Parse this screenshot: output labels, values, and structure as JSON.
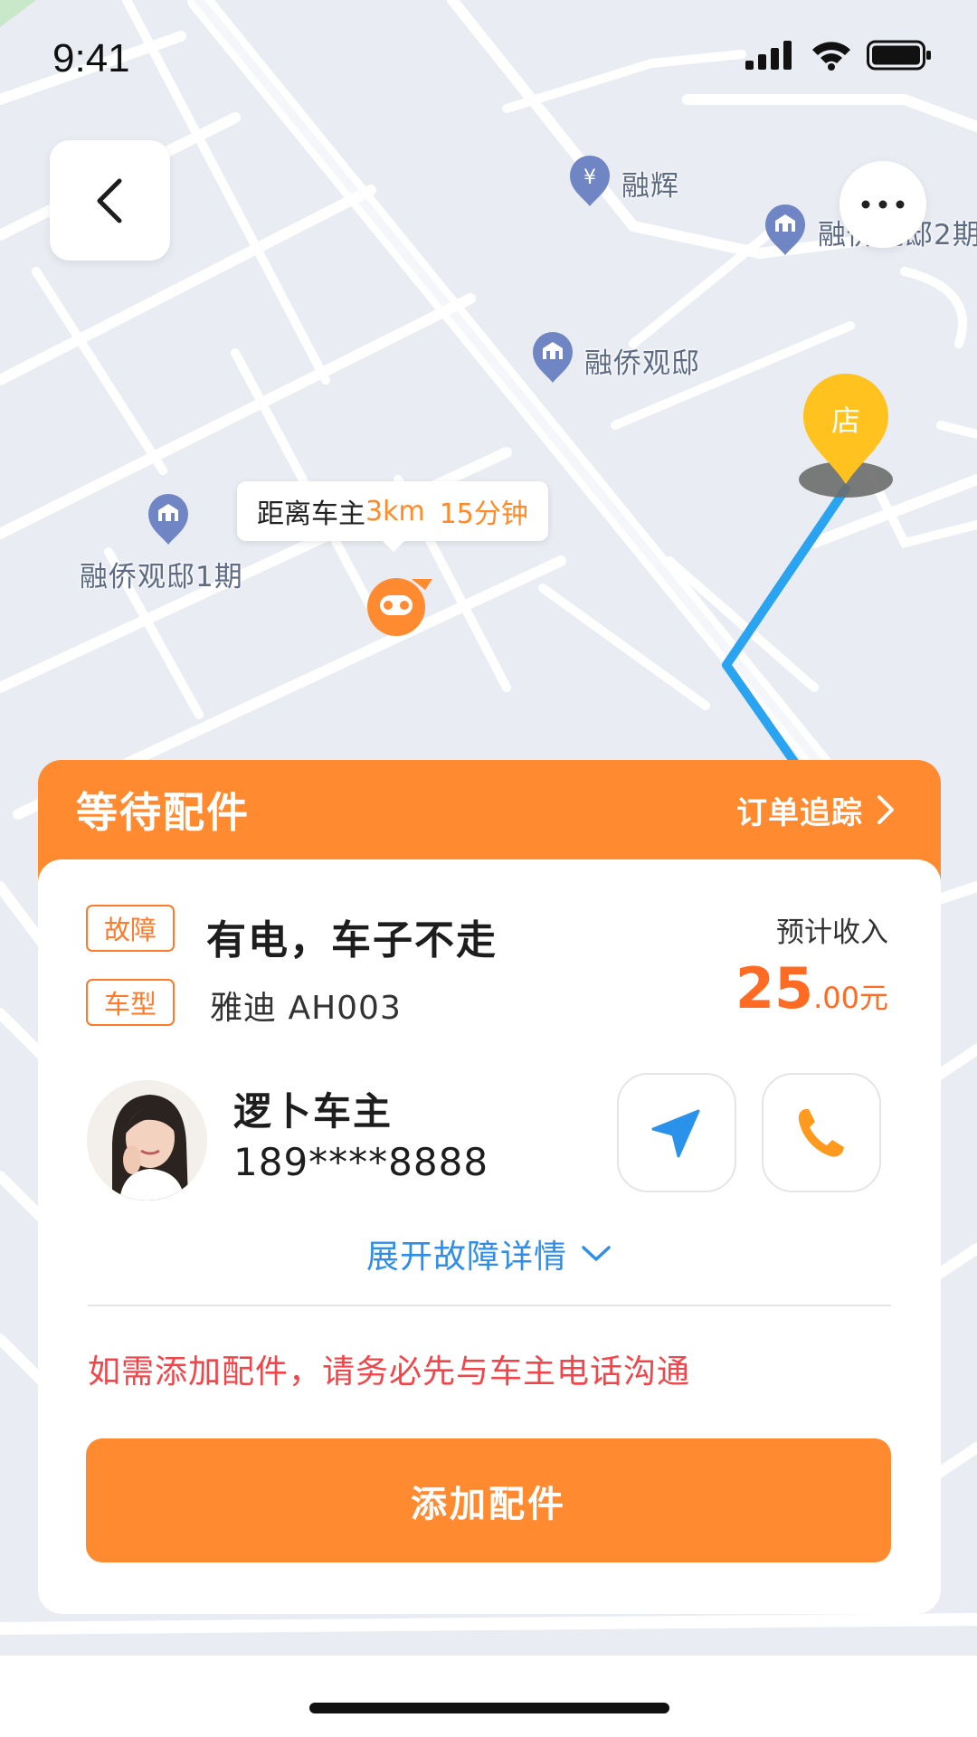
{
  "status_bar": {
    "time": "9:41"
  },
  "map": {
    "pois": [
      {
        "label": "融辉"
      },
      {
        "label": "融侨观邸2期"
      },
      {
        "label": "融侨观邸"
      },
      {
        "label": "融侨观邸1期"
      }
    ],
    "store_marker": "店",
    "distance_callout": {
      "prefix": "距离车主 ",
      "distance": "3km",
      "eta": "15分钟"
    }
  },
  "card": {
    "status": "等待配件",
    "track_label": "订单追踪",
    "fault_tag": "故障",
    "fault": "有电，车子不走",
    "model_tag": "车型",
    "model": "雅迪  AH003",
    "income_label": "预计收入",
    "income_integer": "25",
    "income_suffix": ".00元",
    "owner_name": "逻卜车主",
    "owner_phone": "189****8888",
    "expand_label": "展开故障详情",
    "warning": "如需添加配件，请务必先与车主电话沟通",
    "action_label": "添加配件"
  },
  "colors": {
    "accent": "#ff8a2f",
    "route": "#2aa3f0",
    "warning": "#f2454a",
    "link": "#2f8fe8",
    "store": "#ffc21f"
  }
}
